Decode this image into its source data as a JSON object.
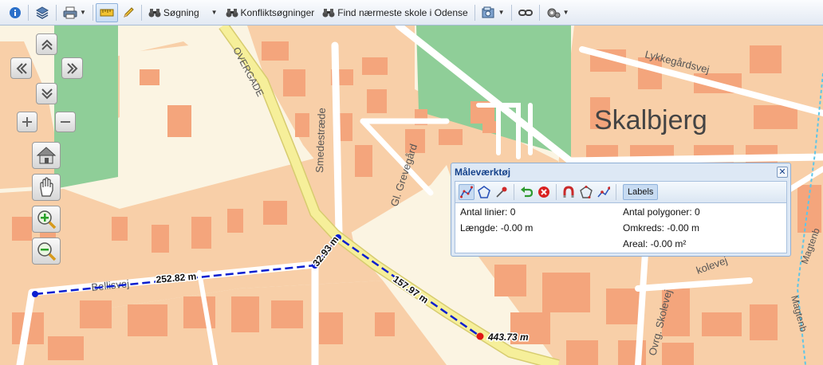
{
  "toolbar": {
    "search_label": "Søgning",
    "conflict_label": "Konfliktsøgninger",
    "school_label": "Find nærmeste skole i Odense",
    "icons": [
      "info-icon",
      "layers-icon",
      "print-icon",
      "ruler-icon",
      "pencil-icon",
      "binoculars-icon",
      "binoculars-icon",
      "binoculars-icon",
      "map-export-icon",
      "link-icon",
      "settings-icon"
    ]
  },
  "map": {
    "place_labels": {
      "skalbjerg": "Skalbjerg",
      "overgade": "OVERGADE",
      "smedestraede": "Smedestræde",
      "gl_grevegard": "Gl. Grevegård",
      "lykkegardsvej": "Lykkegårdsvej",
      "bellisvej": "Bellisvej",
      "ovrg_skolevej": "Ovrg. Skolevej",
      "kolevej": "kolevej",
      "magten1": "Magtenb",
      "magten2": "Magtenb"
    },
    "measure": {
      "seg1": "252.82 m",
      "seg2": "32.93 m",
      "seg3": "157.97 m",
      "total": "443.73 m"
    },
    "colors": {
      "background": "#fbf4e2",
      "building": "#f4a57c",
      "residential": "#f8cfa8",
      "park": "#8fce98",
      "main_road": "#f6ef9a",
      "measure_line": "#0a1fd0",
      "end_point": "#e01515"
    }
  },
  "panel": {
    "title": "Måleværktøj",
    "labels_button": "Labels",
    "lines": "Antal linier: 0",
    "length": "Længde: -0.00 m",
    "polygons": "Antal polygoner: 0",
    "perimeter": "Omkreds: -0.00 m",
    "area": "Areal: -0.00 m²"
  }
}
